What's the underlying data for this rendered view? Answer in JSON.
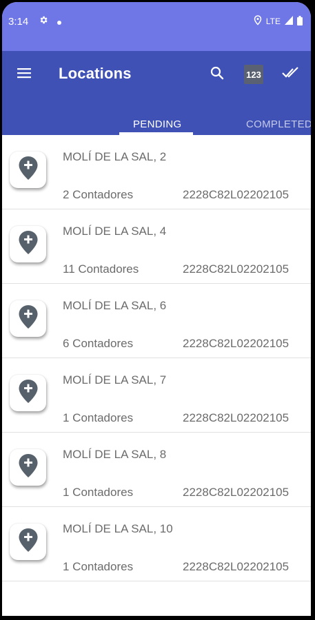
{
  "status_bar": {
    "time": "3:14",
    "network": "LTE",
    "icons": [
      "gear-icon",
      "dot-icon",
      "location-icon",
      "signal-icon",
      "battery-icon"
    ]
  },
  "app_bar": {
    "title": "Locations",
    "badge_label": "123",
    "icons": [
      "menu-icon",
      "search-icon",
      "double-check-icon"
    ]
  },
  "tabs": [
    {
      "label": "PENDING",
      "selected": true
    },
    {
      "label": "COMPLETED",
      "selected": false
    }
  ],
  "colors": {
    "status_bar": "#6f77e6",
    "app_bar": "#3f51b5",
    "pin": "#56616b"
  },
  "locations": [
    {
      "title": "MOLÍ DE LA SAL, 2",
      "count": "2 Contadores",
      "code": "2228C82L02202105"
    },
    {
      "title": "MOLÍ DE LA SAL, 4",
      "count": "11 Contadores",
      "code": "2228C82L02202105"
    },
    {
      "title": "MOLÍ DE LA SAL, 6",
      "count": "6 Contadores",
      "code": "2228C82L02202105"
    },
    {
      "title": "MOLÍ DE LA SAL, 7",
      "count": "1 Contadores",
      "code": "2228C82L02202105"
    },
    {
      "title": "MOLÍ DE LA SAL, 8",
      "count": "1 Contadores",
      "code": "2228C82L02202105"
    },
    {
      "title": "MOLÍ DE LA SAL, 10",
      "count": "1 Contadores",
      "code": "2228C82L02202105"
    }
  ]
}
